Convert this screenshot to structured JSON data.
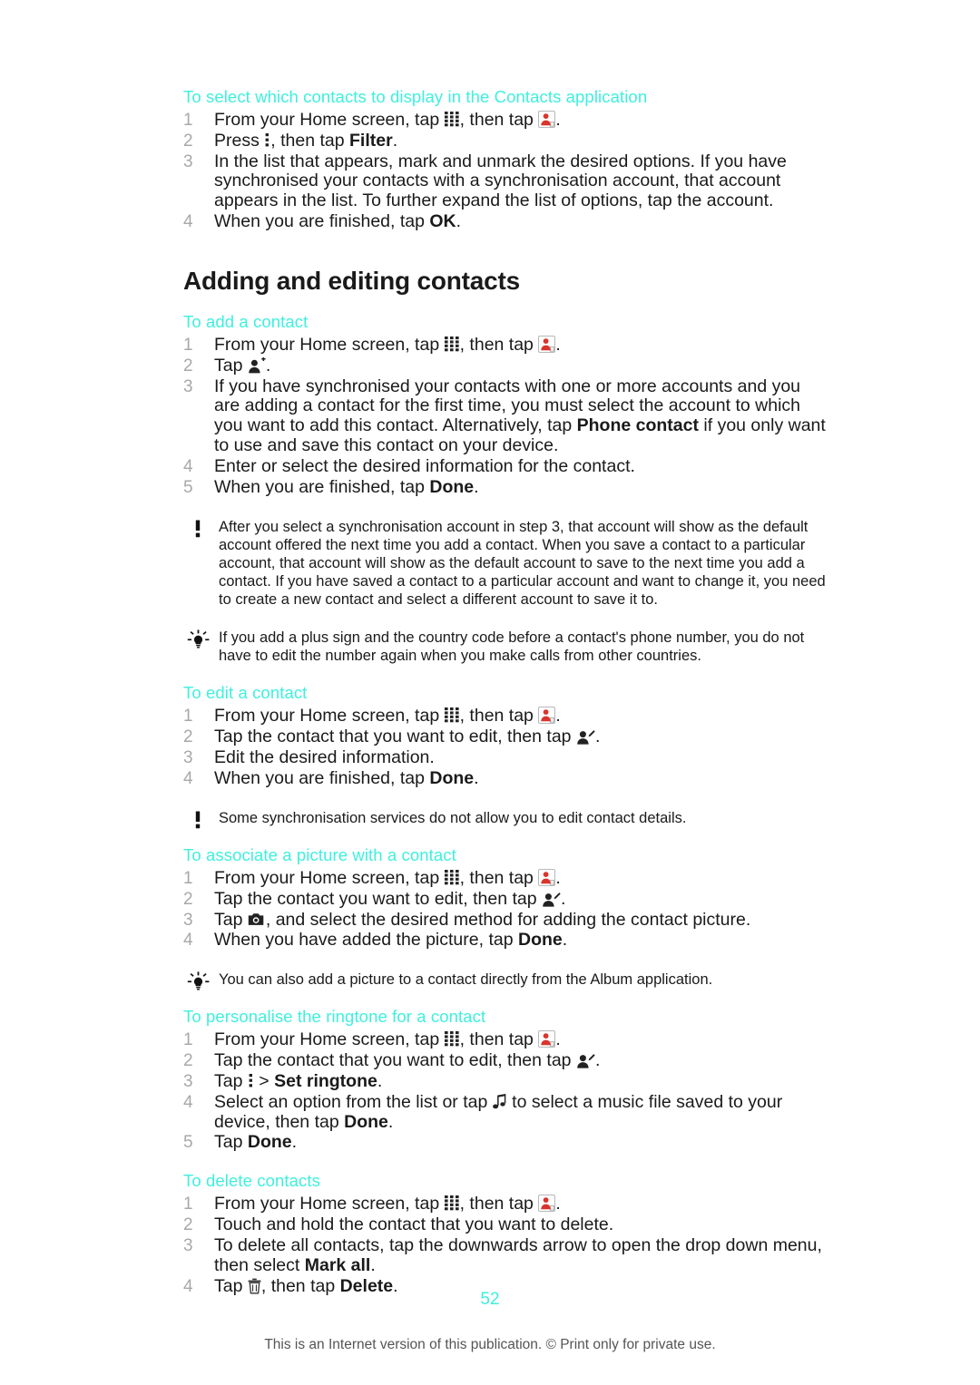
{
  "document": {
    "page_number": "52",
    "copyright": "This is an Internet version of this publication. © Print only for private use."
  },
  "sections": [
    {
      "id": "select-contacts-display",
      "heading": "To select which contacts to display in the Contacts application",
      "steps": [
        {
          "parts": [
            {
              "t": "text",
              "v": "From your Home screen, tap "
            },
            {
              "t": "icon",
              "v": "app-grid-icon"
            },
            {
              "t": "text",
              "v": ", then tap "
            },
            {
              "t": "icon",
              "v": "contacts-app-icon"
            },
            {
              "t": "text",
              "v": "."
            }
          ]
        },
        {
          "parts": [
            {
              "t": "text",
              "v": "Press "
            },
            {
              "t": "icon",
              "v": "overflow-menu-icon"
            },
            {
              "t": "text",
              "v": ", then tap "
            },
            {
              "t": "bold",
              "v": "Filter"
            },
            {
              "t": "text",
              "v": "."
            }
          ]
        },
        {
          "parts": [
            {
              "t": "text",
              "v": "In the list that appears, mark and unmark the desired options. If you have synchronised your contacts with a synchronisation account, that account appears in the list. To further expand the list of options, tap the account."
            }
          ]
        },
        {
          "parts": [
            {
              "t": "text",
              "v": "When you are finished, tap "
            },
            {
              "t": "bold",
              "v": "OK"
            },
            {
              "t": "text",
              "v": "."
            }
          ]
        }
      ]
    }
  ],
  "main_heading": "Adding and editing contacts",
  "subsections": [
    {
      "id": "add-contact",
      "heading": "To add a contact",
      "steps": [
        {
          "parts": [
            {
              "t": "text",
              "v": "From your Home screen, tap "
            },
            {
              "t": "icon",
              "v": "app-grid-icon"
            },
            {
              "t": "text",
              "v": ", then tap "
            },
            {
              "t": "icon",
              "v": "contacts-app-icon"
            },
            {
              "t": "text",
              "v": "."
            }
          ]
        },
        {
          "parts": [
            {
              "t": "text",
              "v": "Tap "
            },
            {
              "t": "icon",
              "v": "add-contact-icon"
            },
            {
              "t": "text",
              "v": "."
            }
          ]
        },
        {
          "parts": [
            {
              "t": "text",
              "v": "If you have synchronised your contacts with one or more accounts and you are adding a contact for the first time, you must select the account to which you want to add this contact. Alternatively, tap "
            },
            {
              "t": "bold",
              "v": "Phone contact"
            },
            {
              "t": "text",
              "v": " if you only want to use and save this contact on your device."
            }
          ]
        },
        {
          "parts": [
            {
              "t": "text",
              "v": "Enter or select the desired information for the contact."
            }
          ]
        },
        {
          "parts": [
            {
              "t": "text",
              "v": "When you are finished, tap "
            },
            {
              "t": "bold",
              "v": "Done"
            },
            {
              "t": "text",
              "v": "."
            }
          ]
        }
      ],
      "notes": [
        {
          "icon": "exclamation-note-icon",
          "text": "After you select a synchronisation account in step 3, that account will show as the default account offered the next time you add a contact. When you save a contact to a particular account, that account will show as the default account to save to the next time you add a contact. If you have saved a contact to a particular account and want to change it, you need to create a new contact and select a different account to save it to."
        },
        {
          "icon": "lightbulb-tip-icon",
          "text": "If you add a plus sign and the country code before a contact's phone number, you do not have to edit the number again when you make calls from other countries."
        }
      ]
    },
    {
      "id": "edit-contact",
      "heading": "To edit a contact",
      "steps": [
        {
          "parts": [
            {
              "t": "text",
              "v": "From your Home screen, tap "
            },
            {
              "t": "icon",
              "v": "app-grid-icon"
            },
            {
              "t": "text",
              "v": ", then tap "
            },
            {
              "t": "icon",
              "v": "contacts-app-icon"
            },
            {
              "t": "text",
              "v": "."
            }
          ]
        },
        {
          "parts": [
            {
              "t": "text",
              "v": "Tap the contact that you want to edit, then tap "
            },
            {
              "t": "icon",
              "v": "edit-contact-icon"
            },
            {
              "t": "text",
              "v": "."
            }
          ]
        },
        {
          "parts": [
            {
              "t": "text",
              "v": "Edit the desired information."
            }
          ]
        },
        {
          "parts": [
            {
              "t": "text",
              "v": "When you are finished, tap "
            },
            {
              "t": "bold",
              "v": "Done"
            },
            {
              "t": "text",
              "v": "."
            }
          ]
        }
      ],
      "notes": [
        {
          "icon": "exclamation-note-icon",
          "text": "Some synchronisation services do not allow you to edit contact details."
        }
      ]
    },
    {
      "id": "associate-picture",
      "heading": "To associate a picture with a contact",
      "steps": [
        {
          "parts": [
            {
              "t": "text",
              "v": "From your Home screen, tap "
            },
            {
              "t": "icon",
              "v": "app-grid-icon"
            },
            {
              "t": "text",
              "v": ", then tap "
            },
            {
              "t": "icon",
              "v": "contacts-app-icon"
            },
            {
              "t": "text",
              "v": "."
            }
          ]
        },
        {
          "parts": [
            {
              "t": "text",
              "v": "Tap the contact you want to edit, then tap "
            },
            {
              "t": "icon",
              "v": "edit-contact-icon"
            },
            {
              "t": "text",
              "v": "."
            }
          ]
        },
        {
          "parts": [
            {
              "t": "text",
              "v": "Tap "
            },
            {
              "t": "icon",
              "v": "camera-icon"
            },
            {
              "t": "text",
              "v": ", and select the desired method for adding the contact picture."
            }
          ]
        },
        {
          "parts": [
            {
              "t": "text",
              "v": "When you have added the picture, tap "
            },
            {
              "t": "bold",
              "v": "Done"
            },
            {
              "t": "text",
              "v": "."
            }
          ]
        }
      ],
      "notes": [
        {
          "icon": "lightbulb-tip-icon",
          "text": "You can also add a picture to a contact directly from the Album application."
        }
      ]
    },
    {
      "id": "personalise-ringtone",
      "heading": "To personalise the ringtone for a contact",
      "steps": [
        {
          "parts": [
            {
              "t": "text",
              "v": "From your Home screen, tap "
            },
            {
              "t": "icon",
              "v": "app-grid-icon"
            },
            {
              "t": "text",
              "v": ", then tap "
            },
            {
              "t": "icon",
              "v": "contacts-app-icon"
            },
            {
              "t": "text",
              "v": "."
            }
          ]
        },
        {
          "parts": [
            {
              "t": "text",
              "v": "Tap the contact that you want to edit, then tap "
            },
            {
              "t": "icon",
              "v": "edit-contact-icon"
            },
            {
              "t": "text",
              "v": "."
            }
          ]
        },
        {
          "parts": [
            {
              "t": "text",
              "v": "Tap "
            },
            {
              "t": "icon",
              "v": "overflow-menu-icon"
            },
            {
              "t": "text",
              "v": " > "
            },
            {
              "t": "bold",
              "v": "Set ringtone"
            },
            {
              "t": "text",
              "v": "."
            }
          ]
        },
        {
          "parts": [
            {
              "t": "text",
              "v": "Select an option from the list or tap "
            },
            {
              "t": "icon",
              "v": "music-note-icon"
            },
            {
              "t": "text",
              "v": " to select a music file saved to your device, then tap "
            },
            {
              "t": "bold",
              "v": "Done"
            },
            {
              "t": "text",
              "v": "."
            }
          ]
        },
        {
          "parts": [
            {
              "t": "text",
              "v": "Tap "
            },
            {
              "t": "bold",
              "v": "Done"
            },
            {
              "t": "text",
              "v": "."
            }
          ]
        }
      ],
      "notes": []
    },
    {
      "id": "delete-contacts",
      "heading": "To delete contacts",
      "steps": [
        {
          "parts": [
            {
              "t": "text",
              "v": "From your Home screen, tap "
            },
            {
              "t": "icon",
              "v": "app-grid-icon"
            },
            {
              "t": "text",
              "v": ", then tap "
            },
            {
              "t": "icon",
              "v": "contacts-app-icon"
            },
            {
              "t": "text",
              "v": "."
            }
          ]
        },
        {
          "parts": [
            {
              "t": "text",
              "v": "Touch and hold the contact that you want to delete."
            }
          ]
        },
        {
          "parts": [
            {
              "t": "text",
              "v": "To delete all contacts, tap the downwards arrow to open the drop down menu, then select "
            },
            {
              "t": "bold",
              "v": "Mark all"
            },
            {
              "t": "text",
              "v": "."
            }
          ]
        },
        {
          "parts": [
            {
              "t": "text",
              "v": "Tap "
            },
            {
              "t": "icon",
              "v": "trash-icon"
            },
            {
              "t": "text",
              "v": ", then tap "
            },
            {
              "t": "bold",
              "v": "Delete"
            },
            {
              "t": "text",
              "v": "."
            }
          ]
        }
      ],
      "notes": []
    }
  ],
  "colors": {
    "heading_accent": "#3ef0dd",
    "body_text": "#1a1a1a",
    "step_number": "#a8a8a8",
    "footer_text": "#555555",
    "contacts_icon_red": "#d9352c"
  }
}
